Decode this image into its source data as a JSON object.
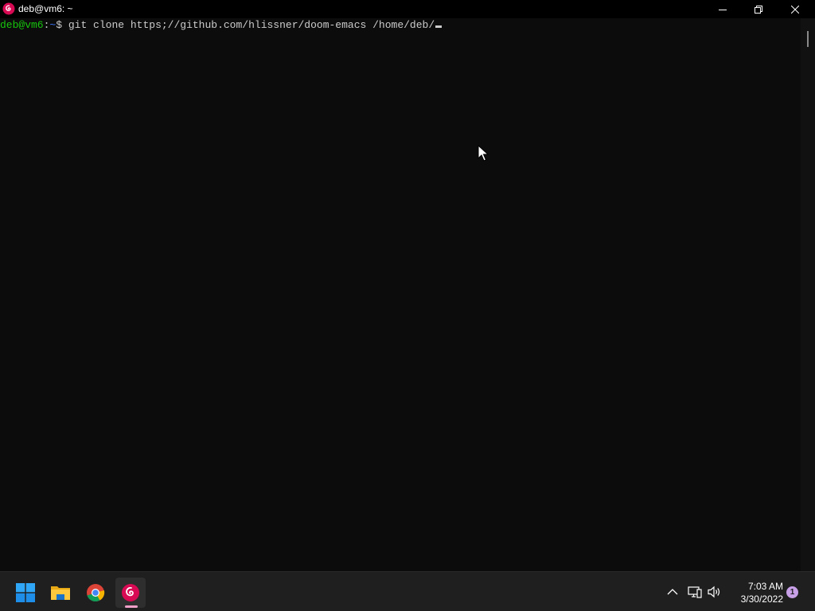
{
  "window": {
    "title": "deb@vm6: ~",
    "icon": "debian-swirl-icon"
  },
  "terminal": {
    "prompt_user": "deb@vm6",
    "prompt_colon": ":",
    "prompt_path": "~",
    "prompt_dollar": "$",
    "command": " git clone https;//github.com/hlissner/doom-emacs /home/deb/"
  },
  "colors": {
    "terminal_bg": "#0c0c0c",
    "prompt_user": "#16c60c",
    "prompt_path": "#3b78ff",
    "taskbar_bg": "#1f1f1f",
    "debian_red": "#d70a53"
  },
  "taskbar": {
    "apps": [
      {
        "name": "Start",
        "icon": "windows-start-icon"
      },
      {
        "name": "File Explorer",
        "icon": "folder-icon"
      },
      {
        "name": "Google Chrome",
        "icon": "chrome-icon"
      },
      {
        "name": "Debian",
        "icon": "debian-swirl-icon",
        "active": true
      }
    ],
    "tray": {
      "time": "7:03 AM",
      "date": "3/30/2022",
      "notifications": "1"
    }
  }
}
